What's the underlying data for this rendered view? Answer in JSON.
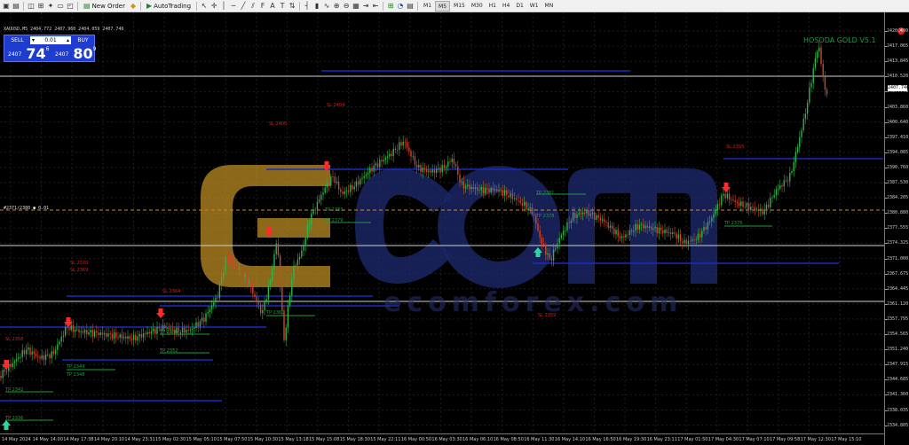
{
  "toolbar": {
    "new_order_label": "New Order",
    "autotrading_label": "AutoTrading",
    "timeframes": [
      "M1",
      "M5",
      "M15",
      "M30",
      "H1",
      "H4",
      "D1",
      "W1",
      "MN"
    ],
    "active_timeframe": "M5",
    "icons": [
      "new-chart-icon",
      "profiles-icon",
      "market-watch-icon",
      "data-window-icon",
      "navigator-icon",
      "terminal-icon",
      "strategy-tester-icon",
      "metaeditor-icon",
      "autotrading-icon",
      "cursor-icon",
      "crosshair-icon",
      "vertical-line-icon",
      "horizontal-line-icon",
      "trendline-icon",
      "channel-icon",
      "fibonacci-icon",
      "text-icon",
      "label-icon",
      "arrows-icon",
      "bar-chart-icon",
      "candlestick-icon",
      "line-chart-icon",
      "zoom-in-icon",
      "zoom-out-icon",
      "tile-icon",
      "autoscroll-icon",
      "chart-shift-icon",
      "indicators-icon",
      "periods-icon",
      "templates-icon"
    ]
  },
  "chart": {
    "symbol_line": "XAUUSD,M5  2404.772 2407.960 2404.059 2407.746",
    "indicator_title": "HOSODA GOLD V5.1",
    "watermark_brand": "ecm",
    "watermark_text": "ecomforex.com",
    "current_price_tag": "2407.746",
    "left_marker": "#2371/2380 ● 0.01",
    "colors": {
      "background": "#000000",
      "bull_candle": "#2fb34a",
      "bear_candle": "#d2452a",
      "sl_text": "#d12020",
      "tp_text": "#1e9d3c",
      "blue_level": "#1a2bbf",
      "watermark_gold": "#d9a32b",
      "watermark_navy": "#1d2666",
      "dashed_orange": "#d6872c"
    }
  },
  "trade_panel": {
    "sell_label": "SELL",
    "buy_label": "BUY",
    "lot_value": "0.01",
    "sell_prefix": "2407",
    "sell_big": "74",
    "sell_sup": "6",
    "buy_prefix": "2407",
    "buy_big": "80",
    "buy_sup": "9"
  },
  "y_axis": {
    "labels": [
      "2420.400",
      "2417.065",
      "2413.845",
      "2410.520",
      "2407.746",
      "2403.860",
      "2400.640",
      "2397.410",
      "2394.085",
      "2390.760",
      "2387.530",
      "2384.205",
      "2380.880",
      "2377.555",
      "2374.325",
      "2371.000",
      "2367.675",
      "2364.445",
      "2361.120",
      "2357.795",
      "2354.565",
      "2351.240",
      "2347.915",
      "2344.685",
      "2341.360",
      "2338.035",
      "2334.805"
    ]
  },
  "x_axis": {
    "labels": [
      "14 May 2024",
      "14 May 14:00",
      "14 May 17:38",
      "14 May 20:10",
      "14 May 23:31",
      "15 May 02:30",
      "15 May 05:10",
      "15 May 07:50",
      "15 May 10:30",
      "15 May 13:18",
      "15 May 15:08",
      "15 May 18:30",
      "15 May 22:11",
      "16 May 00:50",
      "16 May 03:30",
      "16 May 06:10",
      "16 May 08:50",
      "16 May 11:30",
      "16 May 14:10",
      "16 May 16:50",
      "16 May 19:30",
      "16 May 23:11",
      "17 May 01:50",
      "17 May 04:30",
      "17 May 07:10",
      "17 May 09:58",
      "17 May 12:30",
      "17 May 15:10"
    ]
  },
  "annotations": {
    "sl": [
      {
        "text": "SL 2404"
      },
      {
        "text": "SL 2400"
      },
      {
        "text": "SL 2370"
      },
      {
        "text": "SL 2369"
      },
      {
        "text": "SL 2364"
      },
      {
        "text": "SL 2359"
      },
      {
        "text": "SL 2395"
      },
      {
        "text": "SL 2358"
      }
    ],
    "tp": [
      {
        "text": "TP 2383"
      },
      {
        "text": "TP 2379"
      },
      {
        "text": "TP 2381"
      },
      {
        "text": "TP 2378"
      },
      {
        "text": "TP 2376"
      },
      {
        "text": "TP 2360"
      },
      {
        "text": "TP 2356"
      },
      {
        "text": "TP 2352"
      },
      {
        "text": "TP 2349"
      },
      {
        "text": "TP 2348"
      },
      {
        "text": "TP 2342"
      },
      {
        "text": "TP 2336"
      }
    ]
  }
}
